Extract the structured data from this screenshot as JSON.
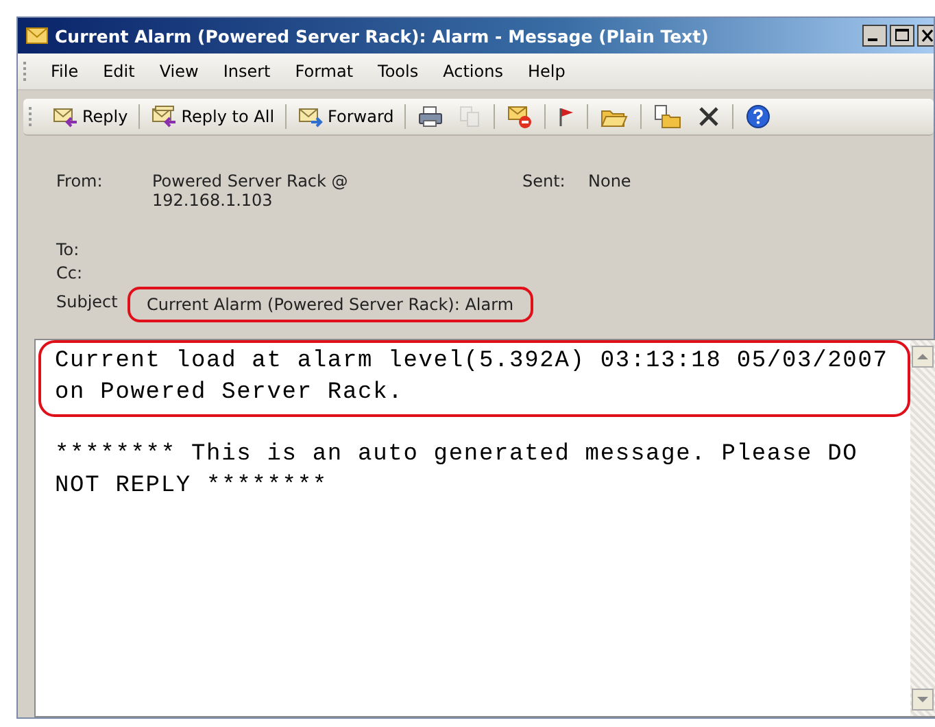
{
  "window": {
    "title": "Current Alarm (Powered Server Rack): Alarm - Message (Plain Text)"
  },
  "menu": [
    "File",
    "Edit",
    "View",
    "Insert",
    "Format",
    "Tools",
    "Actions",
    "Help"
  ],
  "toolbar": [
    {
      "kind": "text",
      "label": "Reply"
    },
    {
      "kind": "text",
      "label": "Reply to All"
    },
    {
      "kind": "text",
      "label": "Forward"
    },
    {
      "kind": "icon",
      "disabled": false
    },
    {
      "kind": "icon",
      "disabled": true
    },
    {
      "kind": "icon",
      "disabled": false
    },
    {
      "kind": "icon",
      "disabled": false
    },
    {
      "kind": "icon",
      "disabled": false
    },
    {
      "kind": "icon",
      "disabled": false
    },
    {
      "kind": "icon",
      "disabled": false
    },
    {
      "kind": "icon",
      "disabled": false
    }
  ],
  "header": {
    "from_label": "From:",
    "from": "Powered Server Rack @ 192.168.1.103",
    "sent_label": "Sent:",
    "sent": "None",
    "to_label": "To:",
    "cc_label": "Cc:",
    "subject_label": "Subject",
    "subject": "Current Alarm (Powered Server Rack): Alarm",
    "subject_highlighted": true
  },
  "body": [
    {
      "text": "Current load at alarm level(5.392A) 03:13:18 05/03/2007 on Powered Server Rack.",
      "highlighted": true
    },
    {
      "text": "******** This is an auto generated message. Please DO NOT REPLY ********",
      "highlighted": false
    }
  ]
}
